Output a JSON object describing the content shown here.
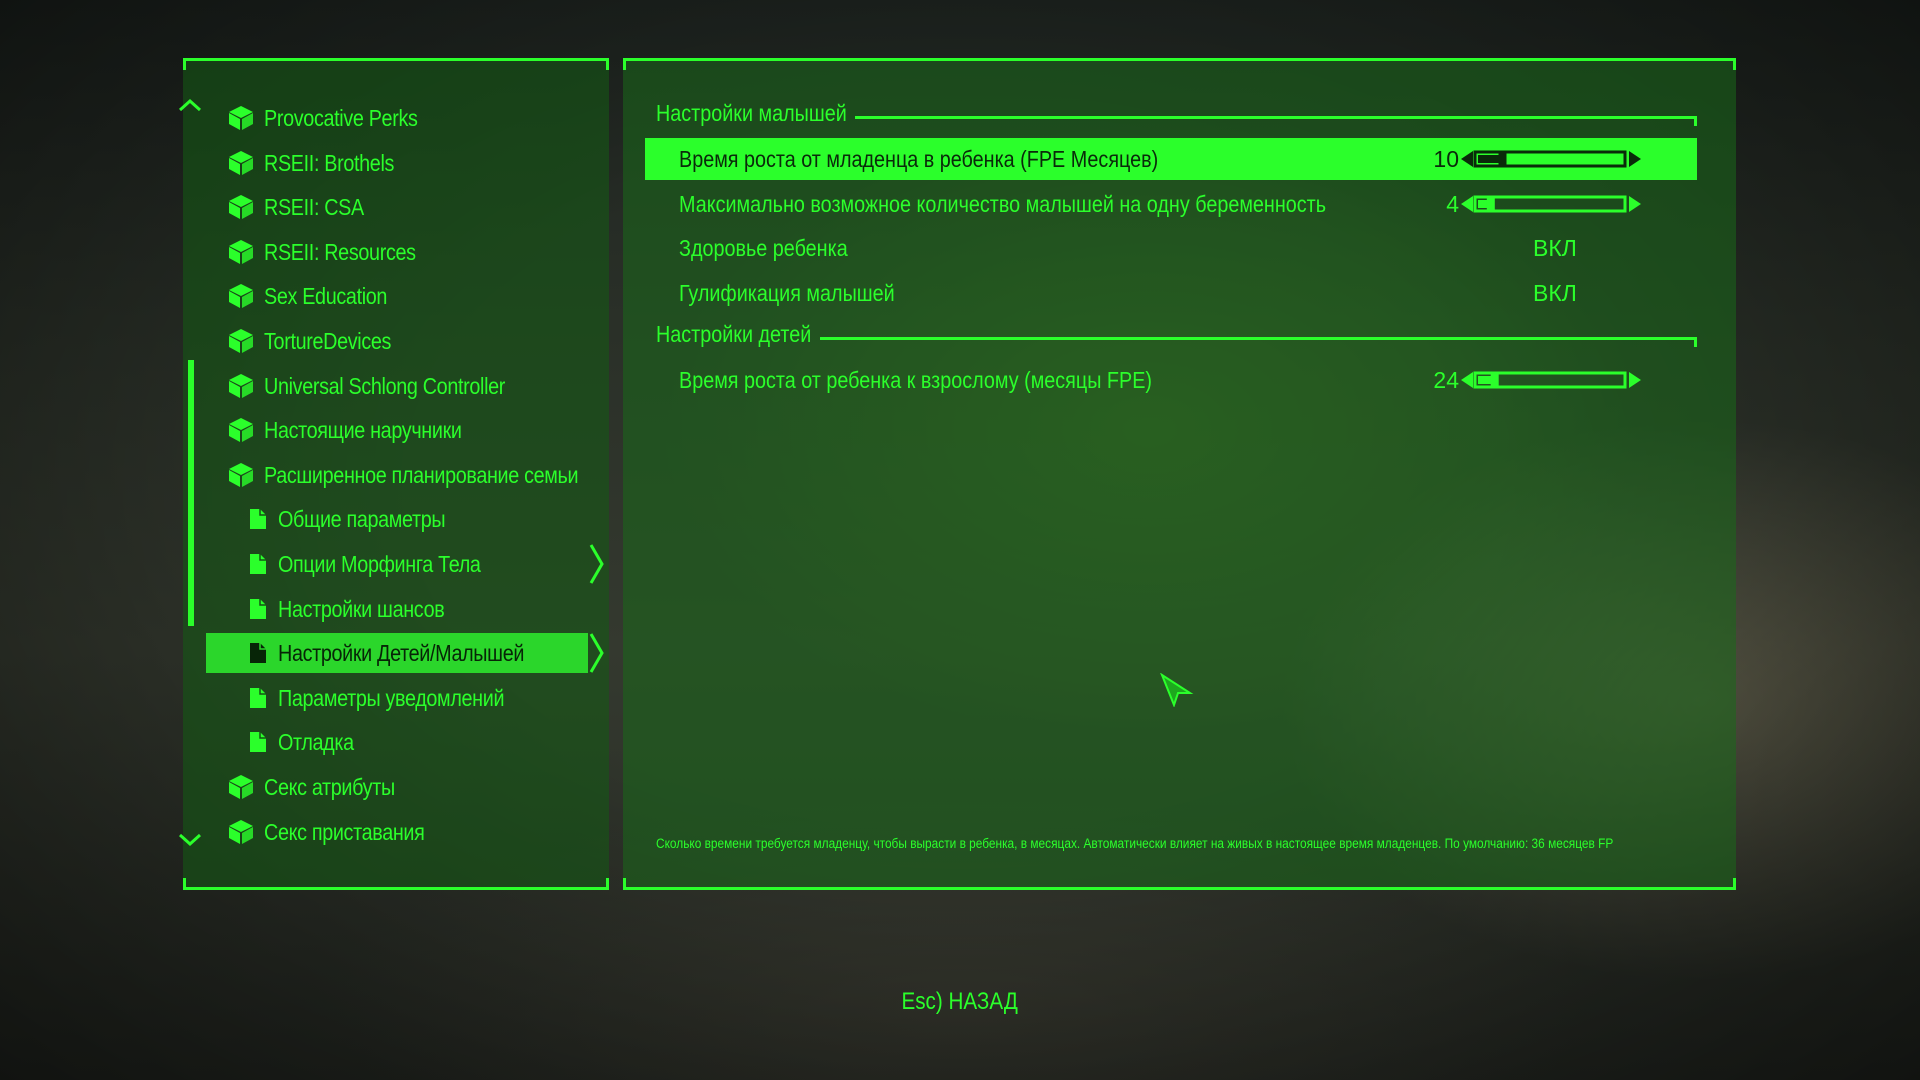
{
  "mod_list": {
    "items": [
      {
        "label": "Provocative Perks",
        "kind": "mod",
        "icon": "package-icon"
      },
      {
        "label": "RSEII: Brothels",
        "kind": "mod",
        "icon": "package-icon"
      },
      {
        "label": "RSEII: CSA",
        "kind": "mod",
        "icon": "package-icon"
      },
      {
        "label": "RSEII: Resources",
        "kind": "mod",
        "icon": "package-icon"
      },
      {
        "label": "Sex Education",
        "kind": "mod",
        "icon": "package-icon"
      },
      {
        "label": "TortureDevices",
        "kind": "mod",
        "icon": "package-icon"
      },
      {
        "label": "Universal Schlong Controller",
        "kind": "mod",
        "icon": "package-icon"
      },
      {
        "label": "Настоящие наручники",
        "kind": "mod",
        "icon": "package-icon"
      },
      {
        "label": "Расширенное планирование семьи",
        "kind": "mod",
        "icon": "package-icon"
      },
      {
        "label": "Общие параметры",
        "kind": "page",
        "icon": "page-icon"
      },
      {
        "label": "Опции Морфинга Тела",
        "kind": "page",
        "icon": "page-icon",
        "has_submenu": true
      },
      {
        "label": "Настройки шансов",
        "kind": "page",
        "icon": "page-icon"
      },
      {
        "label": "Настройки Детей/Малышей",
        "kind": "page",
        "icon": "page-icon",
        "selected": true,
        "has_submenu": true
      },
      {
        "label": "Параметры уведомлений",
        "kind": "page",
        "icon": "page-icon"
      },
      {
        "label": "Отладка",
        "kind": "page",
        "icon": "page-icon"
      },
      {
        "label": "Секс атрибуты",
        "kind": "mod",
        "icon": "package-icon"
      },
      {
        "label": "Секс приставания",
        "kind": "mod",
        "icon": "package-icon"
      }
    ]
  },
  "settings": {
    "sections": [
      {
        "title": "Настройки малышей",
        "options": [
          {
            "label": "Время роста от младенца в ребенка (FPE Месяцев)",
            "type": "slider",
            "value": "10",
            "fill": 0.15,
            "selected": true
          },
          {
            "label": "Максимально возможное количество малышей на одну беременность",
            "type": "slider",
            "value": "4",
            "fill": 0.06
          },
          {
            "label": "Здоровье ребенка",
            "type": "toggle",
            "value": "ВКЛ"
          },
          {
            "label": "Гулификация малышей",
            "type": "toggle",
            "value": "ВКЛ"
          }
        ]
      },
      {
        "title": "Настройки детей",
        "options": [
          {
            "label": "Время роста от ребенка к взрослому (месяцы FPE)",
            "type": "slider",
            "value": "24",
            "fill": 0.09
          }
        ]
      }
    ],
    "description": "Сколько времени требуется младенцу, чтобы вырасти в ребенка, в месяцах. Автоматически влияет на живых в настоящее время младенцев. По умолчанию: 36 месяцев FP"
  },
  "footer": {
    "back_hint": "Esc) НАЗАД"
  },
  "colors": {
    "accent": "#2bff2b",
    "selected_bg": "#2bd62b",
    "selected_text": "#072507"
  }
}
